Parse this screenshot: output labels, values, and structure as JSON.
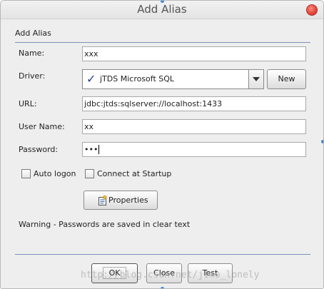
{
  "window": {
    "title": "Add Alias"
  },
  "section": {
    "label": "Add Alias"
  },
  "fields": {
    "name": {
      "label": "Name:",
      "value": "xxx"
    },
    "driver": {
      "label": "Driver:",
      "value": "jTDS Microsoft SQL",
      "new_label": "New"
    },
    "url": {
      "label": "URL:",
      "value": "jdbc:jtds:sqlserver://localhost:1433"
    },
    "user_name": {
      "label": "User Name:",
      "value": "xx"
    },
    "password": {
      "label": "Password:",
      "value": "•••"
    }
  },
  "options": {
    "auto_logon": {
      "label": "Auto logon",
      "checked": false
    },
    "connect_at_startup": {
      "label": "Connect at Startup",
      "checked": false
    }
  },
  "properties_button": "Properties",
  "warning": "Warning - Passwords are saved in clear text",
  "buttons": {
    "ok": "OK",
    "close": "Close",
    "test": "Test"
  },
  "watermark": "http://blog.csdn.net/jimo_lonely",
  "icons": {
    "close": "close-icon",
    "driver_valid": "check-icon",
    "dropdown": "chevron-down-icon",
    "properties": "properties-icon"
  },
  "colors": {
    "close": "#e0443a",
    "check": "#1c3f9e",
    "separator": "#7d8fb8"
  }
}
